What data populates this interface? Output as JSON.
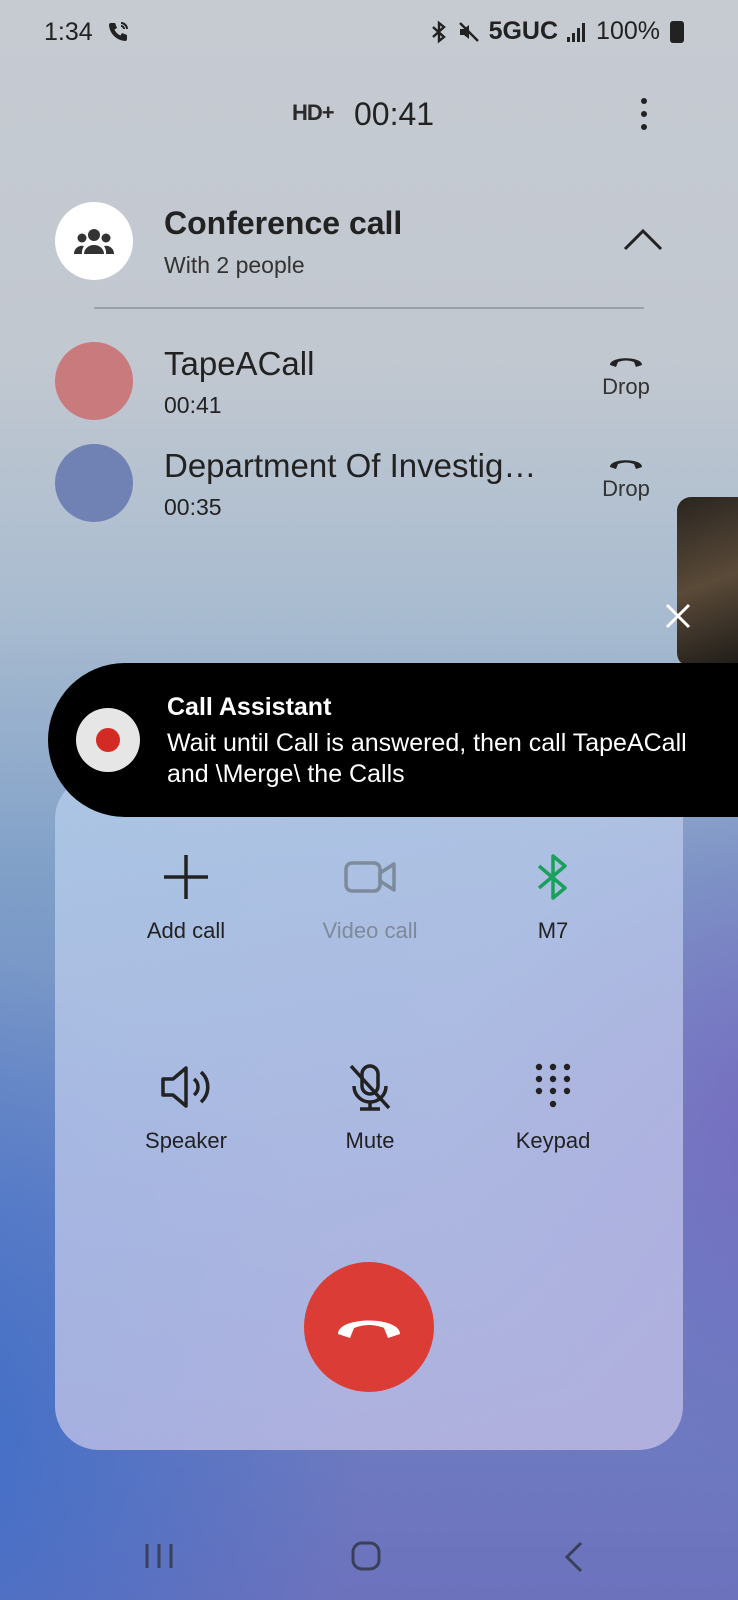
{
  "status_bar": {
    "time": "1:34",
    "network": "5GUC",
    "battery": "100%"
  },
  "call_header": {
    "hd_badge": "HD+",
    "timer": "00:41"
  },
  "conference": {
    "title": "Conference call",
    "subtitle": "With 2 people",
    "participants": [
      {
        "name": "TapeACall",
        "time": "00:41",
        "action": "Drop",
        "avatar_color": "#c97a7d"
      },
      {
        "name": "Department Of Investig…",
        "time": "00:35",
        "action": "Drop",
        "avatar_color": "#7082b4"
      }
    ]
  },
  "toast": {
    "title": "Call Assistant",
    "message": "Wait until Call is answered, then call TapeACall and \\Merge\\ the Calls"
  },
  "controls": {
    "add_call": "Add call",
    "video_call": "Video call",
    "bluetooth": "M7",
    "speaker": "Speaker",
    "mute": "Mute",
    "keypad": "Keypad"
  },
  "colors": {
    "end_call": "#db3c35",
    "bluetooth_accent": "#1aa05a",
    "record_dot": "#d42a24"
  }
}
